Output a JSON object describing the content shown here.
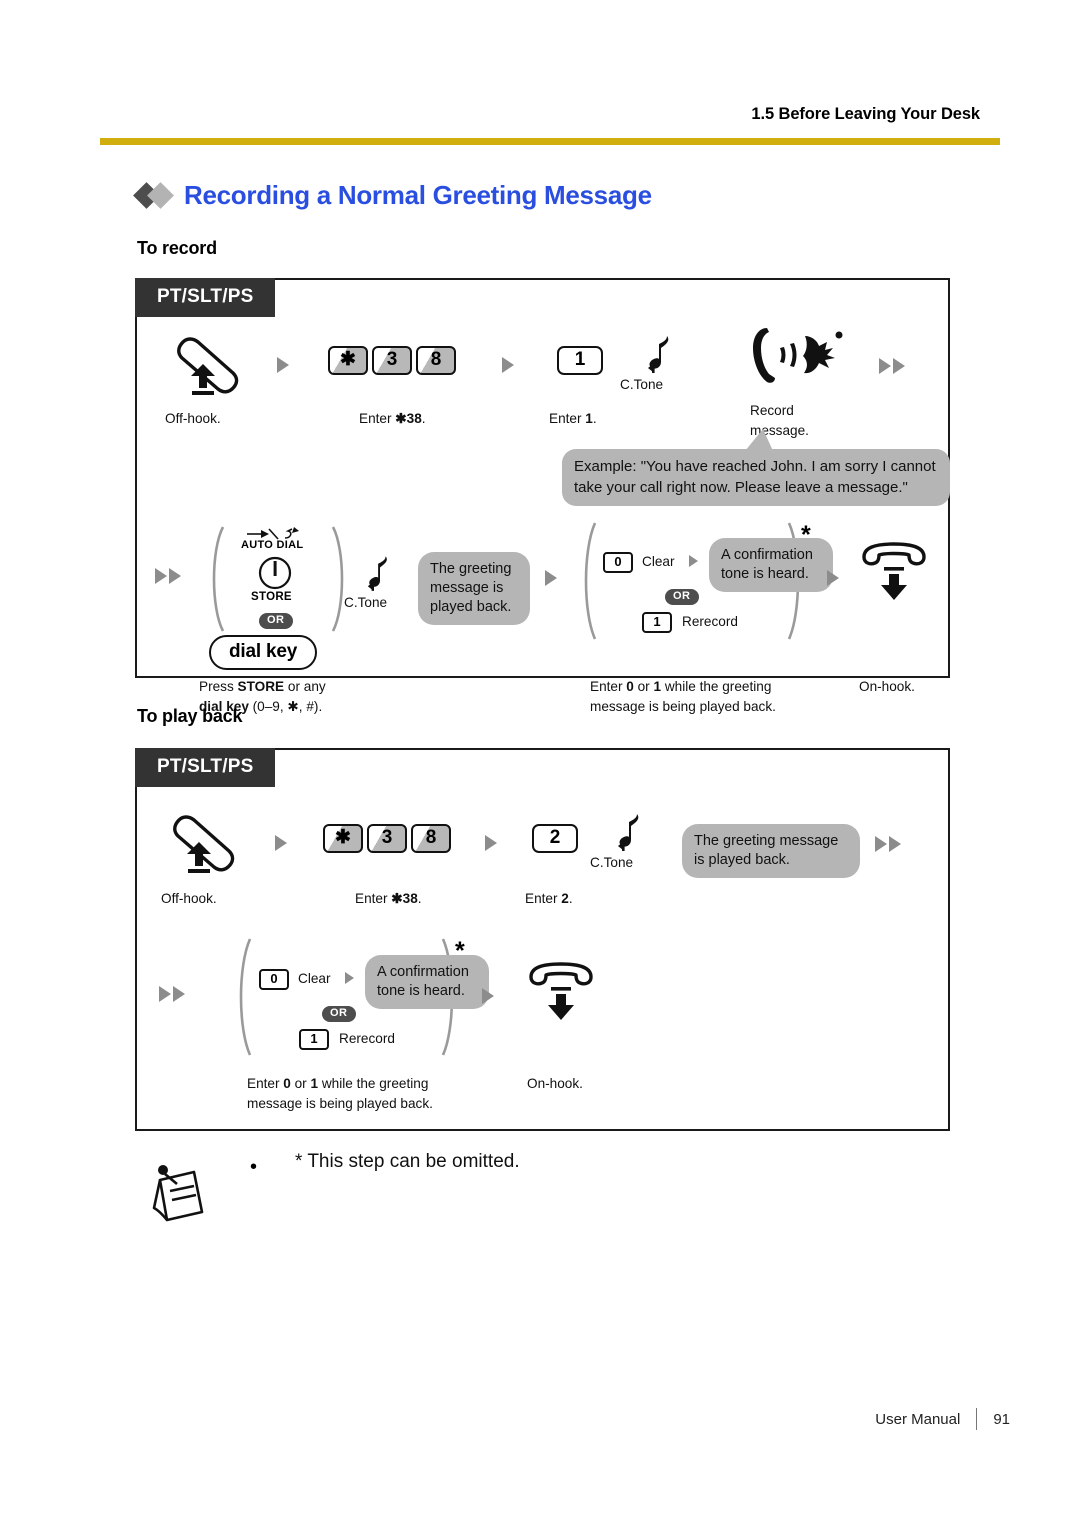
{
  "header": {
    "section": "1.5 Before Leaving Your Desk",
    "rule_color": "#cfae0d"
  },
  "title": {
    "text": "Recording a Normal Greeting Message",
    "color": "#2a4fe0"
  },
  "sections": [
    {
      "heading": "To record",
      "badge": "PT/SLT/PS"
    },
    {
      "heading": "To play back",
      "badge": "PT/SLT/PS"
    }
  ],
  "record": {
    "badge": "PT/SLT/PS",
    "row1": {
      "offhook_caption": "Off-hook.",
      "keys": [
        "✱",
        "3",
        "8"
      ],
      "enter_code_caption_prefix": "Enter ",
      "enter_code_caption_code": "✱38",
      "enter_code_caption_suffix": ".",
      "key1": "1",
      "enter1_prefix": "Enter ",
      "enter1_code": "1",
      "enter1_suffix": ".",
      "ctone": "C.Tone",
      "record_caption_l1": "Record",
      "record_caption_l2": "message.",
      "example_l1": "Example: \"You have reached John. I am sorry I cannot",
      "example_l2": "take your call right now. Please leave a message.\""
    },
    "row2": {
      "auto_dial_label": "AUTO DIAL",
      "store_label": "STORE",
      "or_label": "OR",
      "dial_key_label": "dial key",
      "press_caption_l1_a": "Press ",
      "press_caption_l1_b": "STORE",
      "press_caption_l1_c": " or any",
      "press_caption_l2_a": "dial key",
      "press_caption_l2_b": " (0–9, ✱, #).",
      "ctone": "C.Tone",
      "played_back_l1": "The greeting",
      "played_back_l2": "message is",
      "played_back_l3": "played back.",
      "key_clear": "0",
      "clear_label": "Clear",
      "confirm_l1": "A confirmation",
      "confirm_l2": "tone is heard.",
      "or_label2": "OR",
      "key_rerecord": "1",
      "rerecord_label": "Rerecord",
      "asterisk": "*",
      "enter01_l1_a": "Enter ",
      "enter01_l1_b": "0",
      "enter01_l1_c": " or ",
      "enter01_l1_d": "1",
      "enter01_l1_e": " while the greeting",
      "enter01_l2": "message is being played back.",
      "onhook_caption": "On-hook."
    }
  },
  "playback": {
    "badge": "PT/SLT/PS",
    "row1": {
      "offhook_caption": "Off-hook.",
      "keys": [
        "✱",
        "3",
        "8"
      ],
      "enter_code_caption_prefix": "Enter ",
      "enter_code_caption_code": "✱38",
      "enter_code_caption_suffix": ".",
      "key2": "2",
      "enter2_prefix": "Enter ",
      "enter2_code": "2",
      "enter2_suffix": ".",
      "ctone": "C.Tone",
      "played_back_l1": "The greeting message",
      "played_back_l2": "is played back."
    },
    "row2": {
      "key_clear": "0",
      "clear_label": "Clear",
      "confirm_l1": "A confirmation",
      "confirm_l2": "tone is heard.",
      "or_label": "OR",
      "key_rerecord": "1",
      "rerecord_label": "Rerecord",
      "asterisk": "*",
      "enter01_l1_a": "Enter ",
      "enter01_l1_b": "0",
      "enter01_l1_c": " or ",
      "enter01_l1_d": "1",
      "enter01_l1_e": " while the greeting",
      "enter01_l2": "message is being played back.",
      "onhook_caption": "On-hook."
    }
  },
  "note": {
    "bullet": "•",
    "text": "* This step can be omitted."
  },
  "footer": {
    "label": "User Manual",
    "page": "91"
  }
}
